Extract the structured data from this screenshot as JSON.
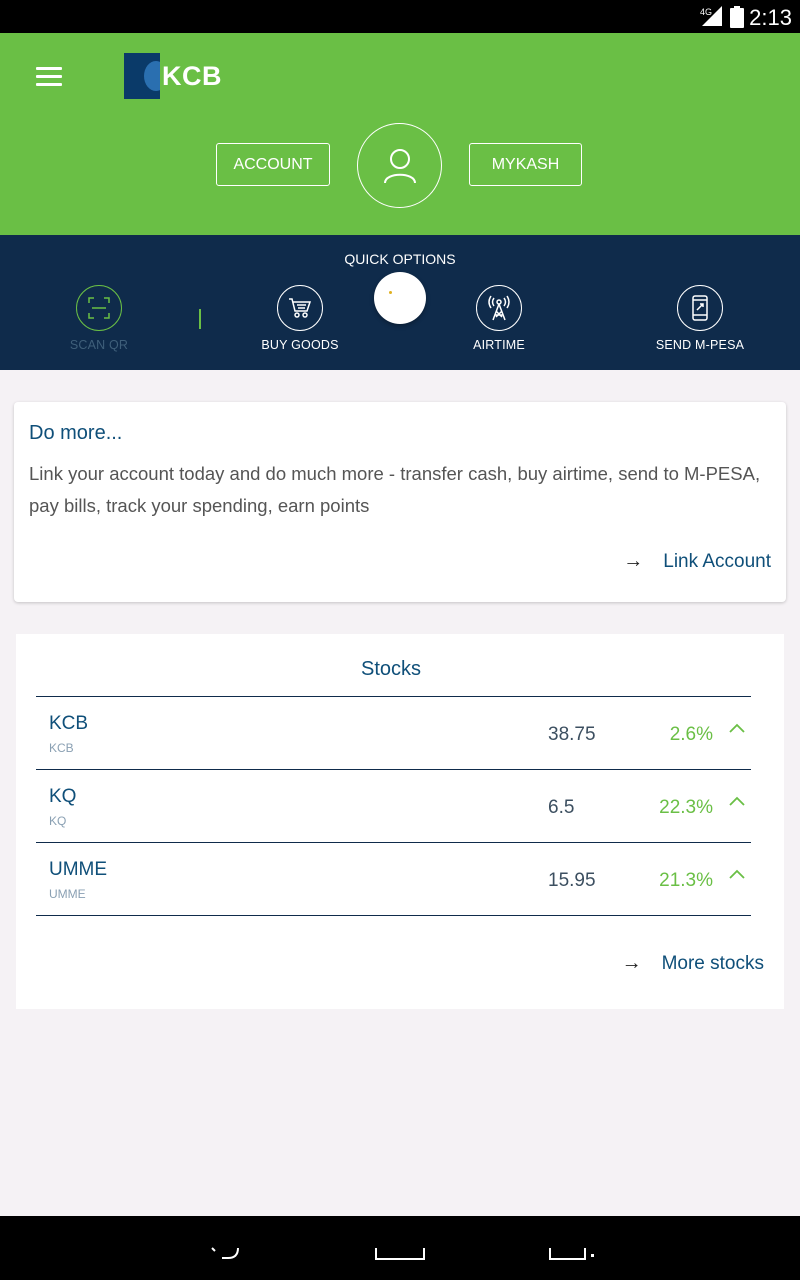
{
  "status_bar": {
    "network": "4G",
    "time": "2:13"
  },
  "header": {
    "logo_text": "KCB",
    "account_button": "ACCOUNT",
    "mykash_button": "MYKASH"
  },
  "quick_options": {
    "title": "QUICK OPTIONS",
    "items": [
      {
        "label": "SCAN QR",
        "icon": "scan-qr-icon"
      },
      {
        "label": "BUY GOODS",
        "icon": "cart-icon"
      },
      {
        "label": "AIRTIME",
        "icon": "antenna-icon"
      },
      {
        "label": "SEND M-PESA",
        "icon": "phone-icon"
      }
    ]
  },
  "do_more": {
    "title": "Do more...",
    "body": "Link your account today and do much more - transfer cash, buy airtime, send to M-PESA, pay bills, track your spending, earn points",
    "link_label": "Link Account"
  },
  "stocks": {
    "title": "Stocks",
    "rows": [
      {
        "symbol": "KCB",
        "sub": "KCB",
        "price": "38.75",
        "change": "2.6%"
      },
      {
        "symbol": "KQ",
        "sub": "KQ",
        "price": "6.5",
        "change": "22.3%"
      },
      {
        "symbol": "UMME",
        "sub": "UMME",
        "price": "15.95",
        "change": "21.3%"
      }
    ],
    "more_label": "More stocks"
  },
  "colors": {
    "green": "#6abf45",
    "navy": "#0f2b4b",
    "link": "#0f4f79"
  }
}
